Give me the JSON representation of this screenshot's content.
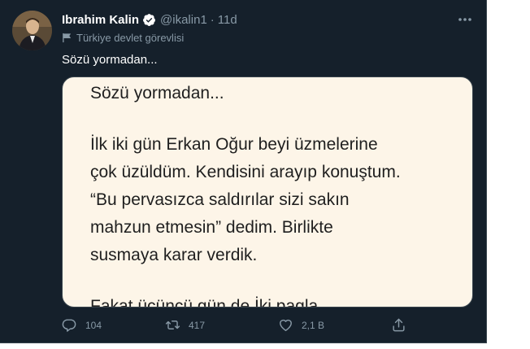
{
  "tweet": {
    "author_name": "Ibrahim Kalin",
    "handle": "@ikalin1",
    "separator": "·",
    "time": "11d",
    "account_label": "Türkiye devlet görevlisi",
    "text": "Sözü yormadan..."
  },
  "media_image": {
    "lines": [
      "Sözü yormadan...",
      "İlk iki gün Erkan Oğur beyi üzmelerine",
      "çok üzüldüm. Kendisini arayıp konuştum.",
      "“Bu pervasızca saldırılar sizi sakın",
      "mahzun etmesin” dedim. Birlikte",
      "susmaya karar verdik.",
      "Fakat üçüncü gün de İki pagla..."
    ]
  },
  "actions": {
    "reply_count": "104",
    "retweet_count": "417",
    "like_count": "2,1 B"
  },
  "colors": {
    "background": "#15202b",
    "text": "#ffffff",
    "muted": "#8899a6",
    "verified": "#ffffff",
    "media_bg": "#fdf5e8"
  }
}
